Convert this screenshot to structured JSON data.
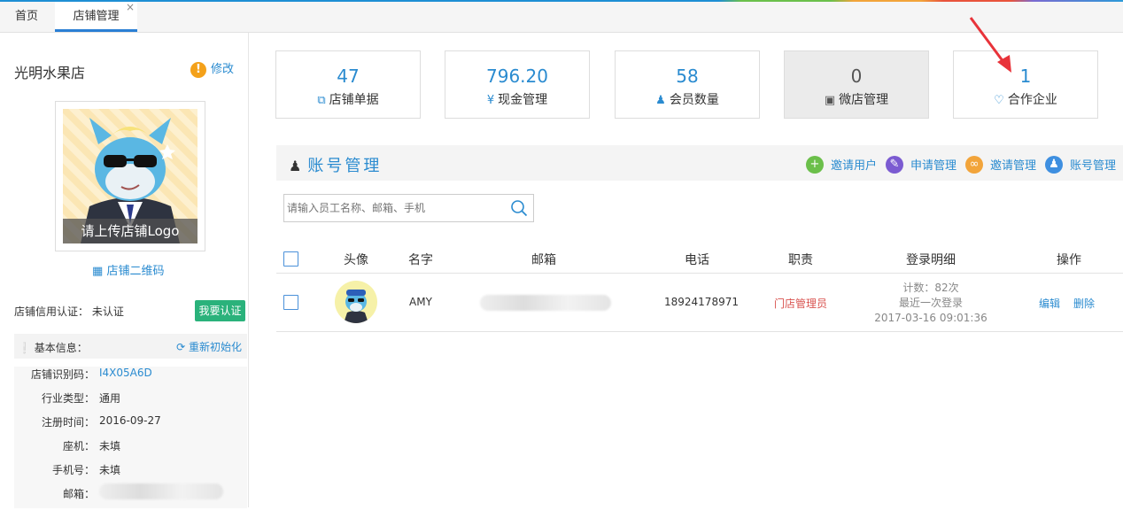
{
  "tabs": {
    "home": "首页",
    "active": "店铺管理",
    "close": "×"
  },
  "shop": {
    "name": "光明水果店",
    "edit_label": "修改",
    "logo_caption": "请上传店铺Logo",
    "qr_label": "店铺二维码",
    "credit_label": "店铺信用认证：",
    "credit_value": "未认证",
    "cert_button": "我要认证",
    "basic_title": "基本信息：",
    "reset_label": "重新初始化",
    "info": [
      {
        "key": "店铺识别码：",
        "value": "I4X05A6D"
      },
      {
        "key": "行业类型：",
        "value": "通用"
      },
      {
        "key": "注册时间：",
        "value": "2016-09-27"
      },
      {
        "key": "座机：",
        "value": "未填"
      },
      {
        "key": "手机号：",
        "value": "未填"
      },
      {
        "key": "邮箱：",
        "value": ""
      }
    ]
  },
  "stats": [
    {
      "value": "47",
      "label": "店铺单据",
      "icon": "copy-icon"
    },
    {
      "value": "796.20",
      "label": "现金管理",
      "icon": "yen-icon"
    },
    {
      "value": "58",
      "label": "会员数量",
      "icon": "user-icon"
    },
    {
      "value": "0",
      "label": "微店管理",
      "icon": "cube-icon"
    },
    {
      "value": "1",
      "label": "合作企业",
      "icon": "heart-icon"
    }
  ],
  "account": {
    "title": "账号管理",
    "actions": [
      {
        "label": "邀请用户",
        "icon": "plus-icon",
        "color": "#6bbf4a"
      },
      {
        "label": "申请管理",
        "icon": "edit-icon",
        "color": "#7b5bd1"
      },
      {
        "label": "邀请管理",
        "icon": "link-icon",
        "color": "#f2a43a"
      },
      {
        "label": "账号管理",
        "icon": "user-icon",
        "color": "#3e8fe0"
      }
    ],
    "search_placeholder": "请输入员工名称、邮箱、手机"
  },
  "table": {
    "headers": [
      "头像",
      "名字",
      "邮箱",
      "电话",
      "职责",
      "登录明细",
      "操作"
    ],
    "rows": [
      {
        "name": "AMY",
        "email": "",
        "phone": "18924178971",
        "role": "门店管理员",
        "login_count": "计数：82次",
        "login_label": "最近一次登录",
        "login_time": "2017-03-16 09:01:36",
        "edit": "编辑",
        "delete": "删除"
      }
    ]
  },
  "colors": {
    "accent": "#2a8bd0",
    "role": "#d9534f",
    "cert": "#2ab27b",
    "annotation_arrow": "#e8333a"
  }
}
